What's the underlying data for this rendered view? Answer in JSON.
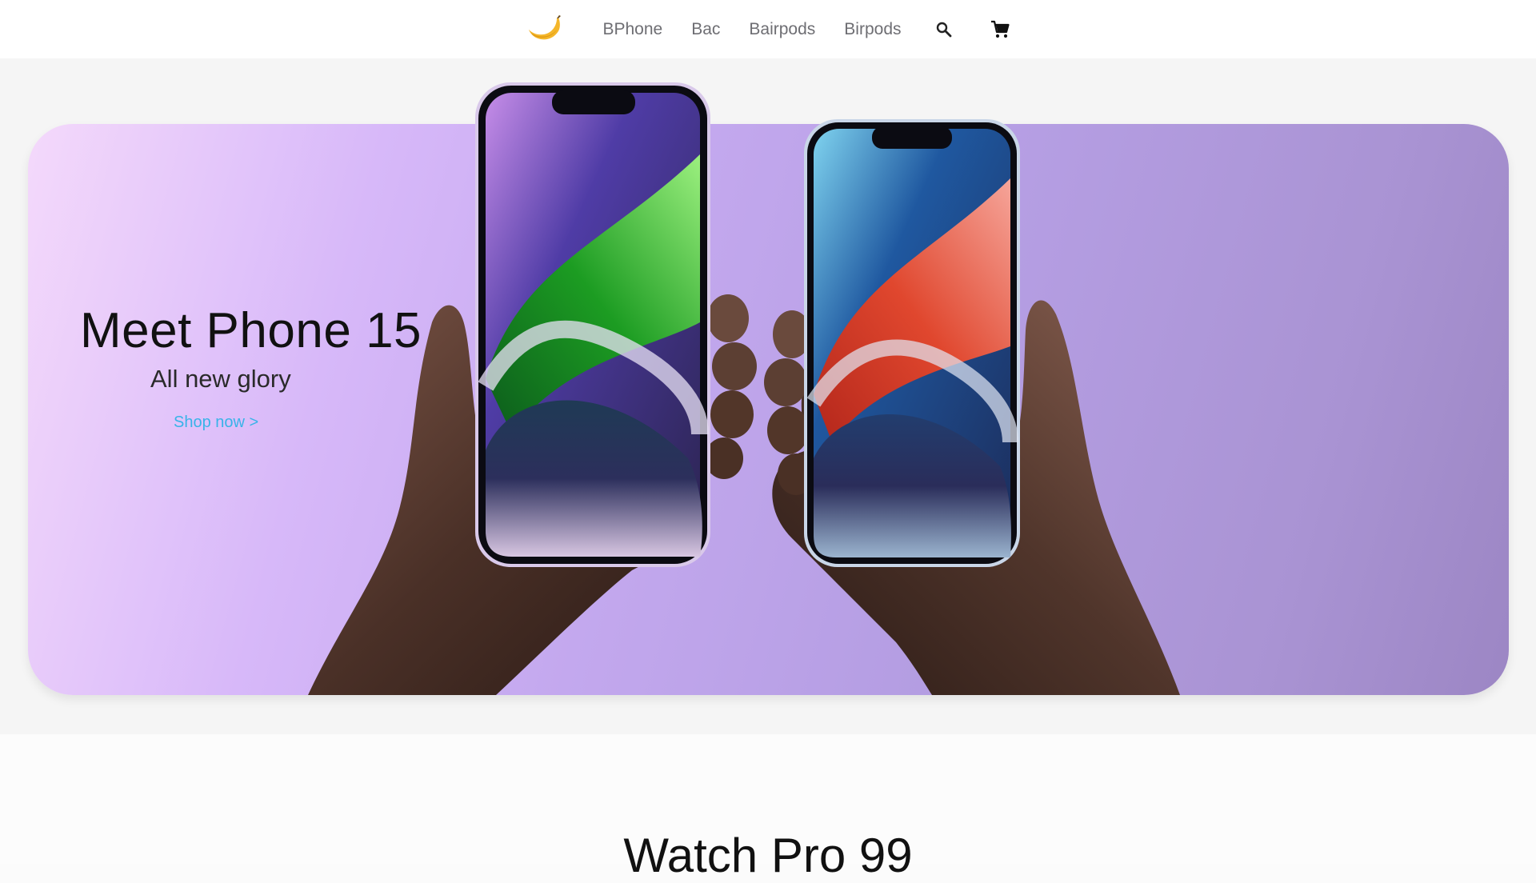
{
  "nav": {
    "logo_icon": "banana-icon",
    "links": [
      "BPhone",
      "Bac",
      "Bairpods",
      "Birpods"
    ],
    "search_icon": "search-icon",
    "cart_icon": "cart-icon"
  },
  "hero": {
    "title": "Meet Phone 15",
    "subtitle": "All new glory",
    "cta": "Shop now >",
    "colors": {
      "cta": "#38b3e8",
      "card_start": "#f4d9fb",
      "card_end": "#9c86c4"
    },
    "image": "two-hands-holding-phones"
  },
  "next_section": {
    "title": "Watch Pro 99"
  }
}
